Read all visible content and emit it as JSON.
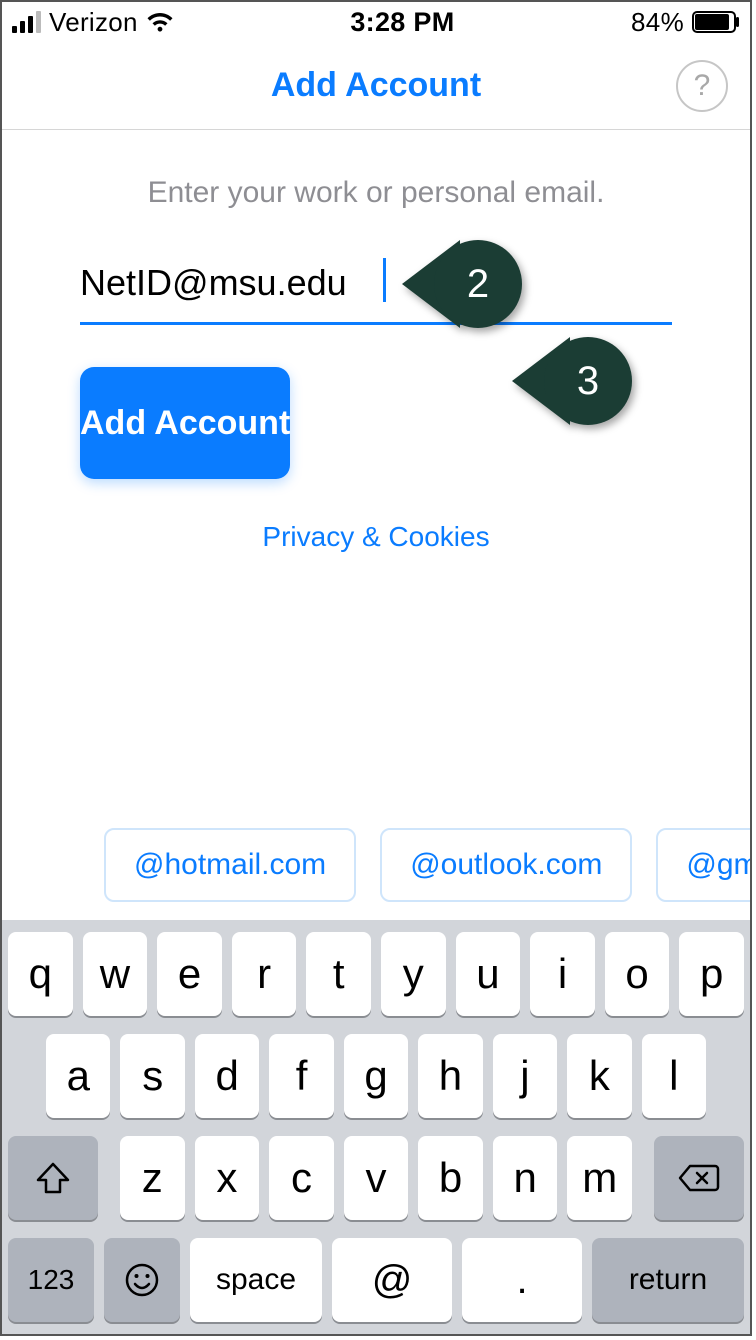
{
  "status": {
    "carrier": "Verizon",
    "time": "3:28 PM",
    "battery_pct": "84%"
  },
  "nav": {
    "title": "Add Account",
    "help_label": "?"
  },
  "main": {
    "prompt": "Enter your work or personal email.",
    "email_value": "NetID@msu.edu",
    "add_button": "Add Account",
    "privacy_link": "Privacy & Cookies"
  },
  "callouts": {
    "email": "2",
    "button": "3"
  },
  "suggestions": [
    "@hotmail.com",
    "@outlook.com",
    "@gmail.com"
  ],
  "keyboard": {
    "row1": [
      "q",
      "w",
      "e",
      "r",
      "t",
      "y",
      "u",
      "i",
      "o",
      "p"
    ],
    "row2": [
      "a",
      "s",
      "d",
      "f",
      "g",
      "h",
      "j",
      "k",
      "l"
    ],
    "row3": [
      "z",
      "x",
      "c",
      "v",
      "b",
      "n",
      "m"
    ],
    "k123": "123",
    "space": "space",
    "at": "@",
    "dot": ".",
    "return": "return"
  }
}
